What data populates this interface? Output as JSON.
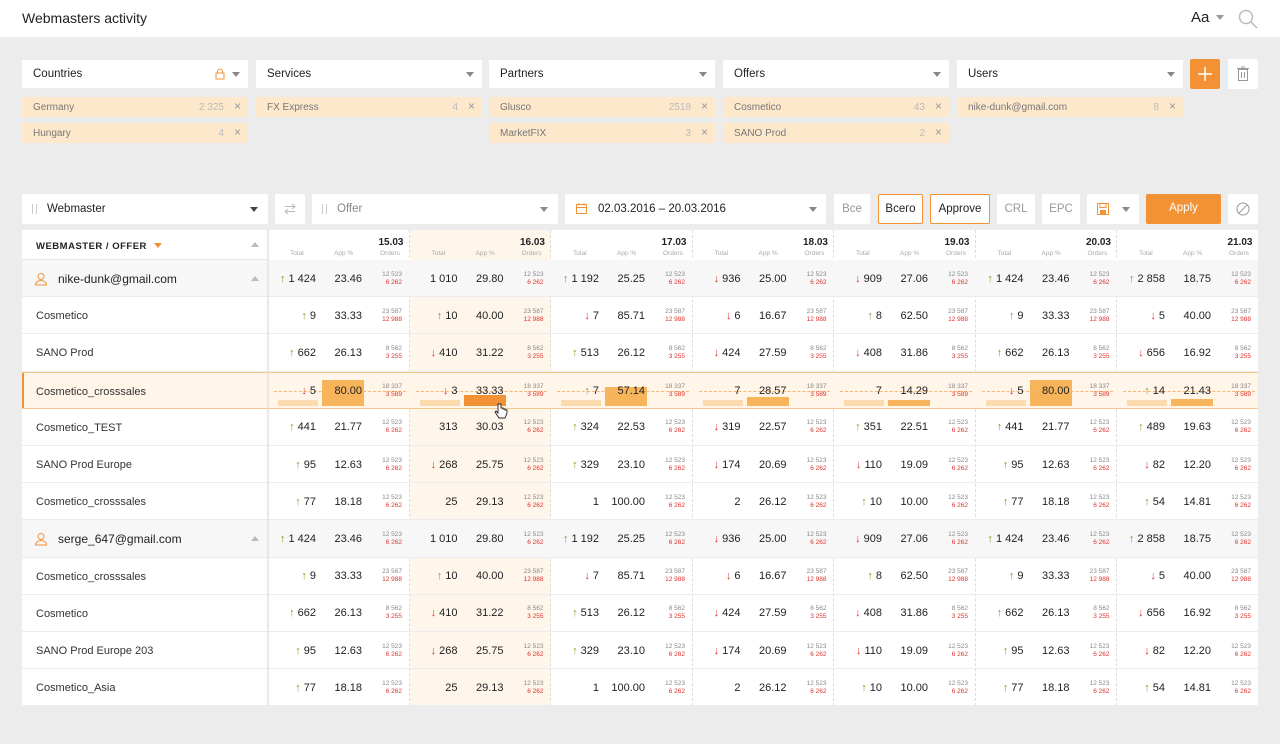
{
  "app_title": "Webmasters activity",
  "font_button": "Aa",
  "filters": [
    {
      "label": "Countries",
      "locked": true,
      "chips": [
        {
          "name": "Germany",
          "count": "2 325"
        },
        {
          "name": "Hungary",
          "count": "4"
        }
      ]
    },
    {
      "label": "Services",
      "locked": false,
      "chips": [
        {
          "name": "FX Express",
          "count": "4"
        }
      ]
    },
    {
      "label": "Partners",
      "locked": false,
      "chips": [
        {
          "name": "Glusco",
          "count": "2518"
        },
        {
          "name": "MarketFIX",
          "count": "3"
        }
      ]
    },
    {
      "label": "Offers",
      "locked": false,
      "chips": [
        {
          "name": "Cosmetico",
          "count": "43"
        },
        {
          "name": "SANO Prod",
          "count": "2"
        }
      ]
    },
    {
      "label": "Users",
      "locked": false,
      "chips": [
        {
          "name": "nike-dunk@gmail.com",
          "count": "8"
        }
      ]
    }
  ],
  "chip_remove": "×",
  "toolbar": {
    "group_primary": "Webmaster",
    "group_secondary": "Offer",
    "date_range": "02.03.2016 – 20.03.2016",
    "btn_all1": "Все",
    "btn_all2": "Всего",
    "btn_approve": "Approve",
    "btn_crl": "CRL",
    "btn_epc": "EPC",
    "apply": "Apply"
  },
  "table": {
    "header_title": "WEBMASTER / OFFER",
    "sub_total": "Total",
    "sub_app": "App %",
    "sub_orders": "Orders",
    "dates": [
      "15.03",
      "16.03",
      "17.03",
      "18.03",
      "19.03",
      "20.03",
      "21.03"
    ],
    "selected_date_index": 1,
    "highlight_row_index": 3,
    "rows": [
      {
        "type": "group",
        "label": "nike-dunk@gmail.com",
        "cells": [
          {
            "d": "up",
            "t": "1 424",
            "a": "23.46",
            "o1": "12 523",
            "o2": "6 262"
          },
          {
            "d": "",
            "t": "1 010",
            "a": "29.80",
            "o1": "12 523",
            "o2": "6 262"
          },
          {
            "d": "up",
            "t": "1 192",
            "a": "25.25",
            "o1": "12 523",
            "o2": "6 262"
          },
          {
            "d": "down",
            "t": "936",
            "a": "25.00",
            "o1": "12 523",
            "o2": "6 262"
          },
          {
            "d": "down",
            "t": "909",
            "a": "27.06",
            "o1": "12 523",
            "o2": "6 262"
          },
          {
            "d": "up",
            "t": "1 424",
            "a": "23.46",
            "o1": "12 523",
            "o2": "6 262"
          },
          {
            "d": "up",
            "t": "2 858",
            "a": "18.75",
            "o1": "12 523",
            "o2": "6 262"
          }
        ]
      },
      {
        "type": "item",
        "label": "Cosmetico",
        "cells": [
          {
            "d": "up",
            "t": "9",
            "a": "33.33",
            "o1": "23 587",
            "o2": "12 988"
          },
          {
            "d": "up",
            "t": "10",
            "a": "40.00",
            "o1": "23 587",
            "o2": "12 988"
          },
          {
            "d": "down",
            "t": "7",
            "a": "85.71",
            "o1": "23 587",
            "o2": "12 988"
          },
          {
            "d": "down",
            "t": "6",
            "a": "16.67",
            "o1": "23 587",
            "o2": "12 988"
          },
          {
            "d": "up",
            "t": "8",
            "a": "62.50",
            "o1": "23 587",
            "o2": "12 988"
          },
          {
            "d": "up",
            "t": "9",
            "a": "33.33",
            "o1": "23 587",
            "o2": "12 988"
          },
          {
            "d": "down",
            "t": "5",
            "a": "40.00",
            "o1": "23 587",
            "o2": "12 988"
          }
        ]
      },
      {
        "type": "item",
        "label": "SANO Prod",
        "cells": [
          {
            "d": "up",
            "t": "662",
            "a": "26.13",
            "o1": "8 562",
            "o2": "3 255"
          },
          {
            "d": "down",
            "t": "410",
            "a": "31.22",
            "o1": "8 562",
            "o2": "3 255"
          },
          {
            "d": "up",
            "t": "513",
            "a": "26.12",
            "o1": "8 562",
            "o2": "3 255"
          },
          {
            "d": "down",
            "t": "424",
            "a": "27.59",
            "o1": "8 562",
            "o2": "3 255"
          },
          {
            "d": "down",
            "t": "408",
            "a": "31.86",
            "o1": "8 562",
            "o2": "3 255"
          },
          {
            "d": "up",
            "t": "662",
            "a": "26.13",
            "o1": "8 562",
            "o2": "3 255"
          },
          {
            "d": "down",
            "t": "656",
            "a": "16.92",
            "o1": "8 562",
            "o2": "3 255"
          }
        ]
      },
      {
        "type": "item",
        "label": "Cosmetico_crosssales",
        "cells": [
          {
            "d": "down",
            "t": "5",
            "a": "80.00",
            "o1": "18 337",
            "o2": "3 589"
          },
          {
            "d": "down",
            "t": "3",
            "a": "33.33",
            "o1": "18 337",
            "o2": "3 589"
          },
          {
            "d": "up",
            "t": "7",
            "a": "57.14",
            "o1": "18 337",
            "o2": "3 589"
          },
          {
            "d": "",
            "t": "7",
            "a": "28.57",
            "o1": "18 337",
            "o2": "3 589"
          },
          {
            "d": "",
            "t": "7",
            "a": "14.29",
            "o1": "18 337",
            "o2": "3 589"
          },
          {
            "d": "down",
            "t": "5",
            "a": "80.00",
            "o1": "18 337",
            "o2": "3 589"
          },
          {
            "d": "up",
            "t": "14",
            "a": "21.43",
            "o1": "18 337",
            "o2": "3 589"
          }
        ]
      },
      {
        "type": "item",
        "label": "Cosmetico_TEST",
        "cells": [
          {
            "d": "up",
            "t": "441",
            "a": "21.77",
            "o1": "12 523",
            "o2": "6 262"
          },
          {
            "d": "",
            "t": "313",
            "a": "30.03",
            "o1": "12 523",
            "o2": "6 262"
          },
          {
            "d": "up",
            "t": "324",
            "a": "22.53",
            "o1": "12 523",
            "o2": "6 262"
          },
          {
            "d": "down",
            "t": "319",
            "a": "22.57",
            "o1": "12 523",
            "o2": "6 262"
          },
          {
            "d": "up",
            "t": "351",
            "a": "22.51",
            "o1": "12 523",
            "o2": "6 262"
          },
          {
            "d": "up",
            "t": "441",
            "a": "21.77",
            "o1": "12 523",
            "o2": "6 262"
          },
          {
            "d": "up",
            "t": "489",
            "a": "19.63",
            "o1": "12 523",
            "o2": "6 262"
          }
        ]
      },
      {
        "type": "item",
        "label": "SANO Prod Europe",
        "cells": [
          {
            "d": "up",
            "t": "95",
            "a": "12.63",
            "o1": "12 523",
            "o2": "6 262"
          },
          {
            "d": "down",
            "t": "268",
            "a": "25.75",
            "o1": "12 523",
            "o2": "6 262"
          },
          {
            "d": "up",
            "t": "329",
            "a": "23.10",
            "o1": "12 523",
            "o2": "6 262"
          },
          {
            "d": "down",
            "t": "174",
            "a": "20.69",
            "o1": "12 523",
            "o2": "6 262"
          },
          {
            "d": "down",
            "t": "110",
            "a": "19.09",
            "o1": "12 523",
            "o2": "6 262"
          },
          {
            "d": "up",
            "t": "95",
            "a": "12.63",
            "o1": "12 523",
            "o2": "6 262"
          },
          {
            "d": "down",
            "t": "82",
            "a": "12.20",
            "o1": "12 523",
            "o2": "6 262"
          }
        ]
      },
      {
        "type": "item",
        "label": "Cosmetico_crosssales",
        "cells": [
          {
            "d": "up",
            "t": "77",
            "a": "18.18",
            "o1": "12 523",
            "o2": "6 262"
          },
          {
            "d": "",
            "t": "25",
            "a": "29.13",
            "o1": "12 523",
            "o2": "6 262"
          },
          {
            "d": "",
            "t": "1",
            "a": "100.00",
            "o1": "12 523",
            "o2": "6 262"
          },
          {
            "d": "",
            "t": "2",
            "a": "26.12",
            "o1": "12 523",
            "o2": "6 262"
          },
          {
            "d": "up",
            "t": "10",
            "a": "10.00",
            "o1": "12 523",
            "o2": "6 262"
          },
          {
            "d": "up",
            "t": "77",
            "a": "18.18",
            "o1": "12 523",
            "o2": "6 262"
          },
          {
            "d": "up",
            "t": "54",
            "a": "14.81",
            "o1": "12 523",
            "o2": "6 262"
          }
        ]
      },
      {
        "type": "group",
        "label": "serge_647@gmail.com",
        "cells": [
          {
            "d": "up",
            "t": "1 424",
            "a": "23.46",
            "o1": "12 523",
            "o2": "6 262"
          },
          {
            "d": "",
            "t": "1 010",
            "a": "29.80",
            "o1": "12 523",
            "o2": "6 262"
          },
          {
            "d": "up",
            "t": "1 192",
            "a": "25.25",
            "o1": "12 523",
            "o2": "6 262"
          },
          {
            "d": "down",
            "t": "936",
            "a": "25.00",
            "o1": "12 523",
            "o2": "6 262"
          },
          {
            "d": "down",
            "t": "909",
            "a": "27.06",
            "o1": "12 523",
            "o2": "6 262"
          },
          {
            "d": "up",
            "t": "1 424",
            "a": "23.46",
            "o1": "12 523",
            "o2": "6 262"
          },
          {
            "d": "up",
            "t": "2 858",
            "a": "18.75",
            "o1": "12 523",
            "o2": "6 262"
          }
        ]
      },
      {
        "type": "item",
        "label": "Cosmetico_crosssales",
        "cells": [
          {
            "d": "up",
            "t": "9",
            "a": "33.33",
            "o1": "23 587",
            "o2": "12 988"
          },
          {
            "d": "up",
            "t": "10",
            "a": "40.00",
            "o1": "23 587",
            "o2": "12 988"
          },
          {
            "d": "down",
            "t": "7",
            "a": "85.71",
            "o1": "23 587",
            "o2": "12 988"
          },
          {
            "d": "down",
            "t": "6",
            "a": "16.67",
            "o1": "23 587",
            "o2": "12 988"
          },
          {
            "d": "up",
            "t": "8",
            "a": "62.50",
            "o1": "23 587",
            "o2": "12 988"
          },
          {
            "d": "up",
            "t": "9",
            "a": "33.33",
            "o1": "23 587",
            "o2": "12 988"
          },
          {
            "d": "down",
            "t": "5",
            "a": "40.00",
            "o1": "23 587",
            "o2": "12 988"
          }
        ]
      },
      {
        "type": "item",
        "label": "Cosmetico",
        "cells": [
          {
            "d": "up",
            "t": "662",
            "a": "26.13",
            "o1": "8 562",
            "o2": "3 255"
          },
          {
            "d": "down",
            "t": "410",
            "a": "31.22",
            "o1": "8 562",
            "o2": "3 255"
          },
          {
            "d": "up",
            "t": "513",
            "a": "26.12",
            "o1": "8 562",
            "o2": "3 255"
          },
          {
            "d": "down",
            "t": "424",
            "a": "27.59",
            "o1": "8 562",
            "o2": "3 255"
          },
          {
            "d": "down",
            "t": "408",
            "a": "31.86",
            "o1": "8 562",
            "o2": "3 255"
          },
          {
            "d": "up",
            "t": "662",
            "a": "26.13",
            "o1": "8 562",
            "o2": "3 255"
          },
          {
            "d": "down",
            "t": "656",
            "a": "16.92",
            "o1": "8 562",
            "o2": "3 255"
          }
        ]
      },
      {
        "type": "item",
        "label": "SANO Prod Europe 203",
        "cells": [
          {
            "d": "up",
            "t": "95",
            "a": "12.63",
            "o1": "12 523",
            "o2": "6 262"
          },
          {
            "d": "down",
            "t": "268",
            "a": "25.75",
            "o1": "12 523",
            "o2": "6 262"
          },
          {
            "d": "up",
            "t": "329",
            "a": "23.10",
            "o1": "12 523",
            "o2": "6 262"
          },
          {
            "d": "down",
            "t": "174",
            "a": "20.69",
            "o1": "12 523",
            "o2": "6 262"
          },
          {
            "d": "down",
            "t": "110",
            "a": "19.09",
            "o1": "12 523",
            "o2": "6 262"
          },
          {
            "d": "up",
            "t": "95",
            "a": "12.63",
            "o1": "12 523",
            "o2": "6 262"
          },
          {
            "d": "down",
            "t": "82",
            "a": "12.20",
            "o1": "12 523",
            "o2": "6 262"
          }
        ]
      },
      {
        "type": "item",
        "label": "Cosmetico_Asia",
        "cells": [
          {
            "d": "up",
            "t": "77",
            "a": "18.18",
            "o1": "12 523",
            "o2": "6 262"
          },
          {
            "d": "",
            "t": "25",
            "a": "29.13",
            "o1": "12 523",
            "o2": "6 262"
          },
          {
            "d": "",
            "t": "1",
            "a": "100.00",
            "o1": "12 523",
            "o2": "6 262"
          },
          {
            "d": "",
            "t": "2",
            "a": "26.12",
            "o1": "12 523",
            "o2": "6 262"
          },
          {
            "d": "up",
            "t": "10",
            "a": "10.00",
            "o1": "12 523",
            "o2": "6 262"
          },
          {
            "d": "up",
            "t": "77",
            "a": "18.18",
            "o1": "12 523",
            "o2": "6 262"
          },
          {
            "d": "up",
            "t": "54",
            "a": "14.81",
            "o1": "12 523",
            "o2": "6 262"
          }
        ]
      }
    ]
  },
  "colors": {
    "accent": "#f39235",
    "up": "#8c9c2a",
    "down": "#e0312b",
    "chip_bg": "#fde8cc"
  },
  "icons": {
    "lock": "lock-icon",
    "search": "search-icon",
    "plus": "plus-icon",
    "trash": "trash-icon",
    "swap": "swap-icon",
    "calendar": "calendar-icon",
    "save": "save-icon",
    "clear": "clear-icon",
    "user": "user-icon",
    "cursor": "hand-cursor-icon"
  }
}
